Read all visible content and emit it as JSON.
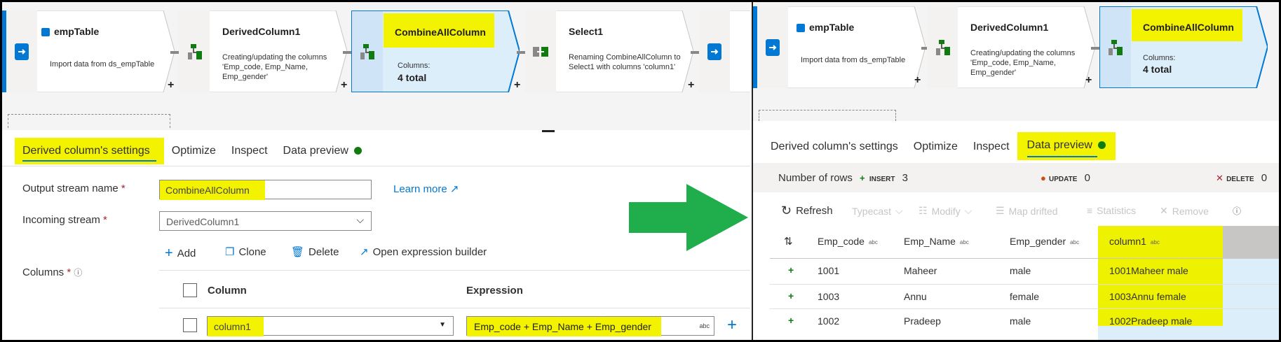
{
  "left": {
    "nodes": [
      {
        "title": "empTable",
        "desc": "Import data from ds_empTable"
      },
      {
        "title": "DerivedColumn1",
        "desc": "Creating/updating the columns 'Emp_code, Emp_Name, Emp_gender'"
      },
      {
        "title": "CombineAllColumn",
        "cols_label": "Columns:",
        "cols_total": "4 total"
      },
      {
        "title": "Select1",
        "desc": "Renaming CombineAllColumn to Select1 with columns 'column1'"
      }
    ],
    "plus": "+",
    "tabs": [
      "Derived column's settings",
      "Optimize",
      "Inspect",
      "Data preview"
    ],
    "output_label": "Output stream name",
    "output_value": "CombineAllColumn",
    "learn_more": "Learn more",
    "incoming_label": "Incoming stream",
    "incoming_value": "DerivedColumn1",
    "required": "*",
    "toolbar": {
      "add": "Add",
      "clone": "Clone",
      "delete": "Delete",
      "expr": "Open expression builder"
    },
    "columns_label": "Columns",
    "col_header": "Column",
    "expr_header": "Expression",
    "row": {
      "column": "column1",
      "expression": "Emp_code + Emp_Name + Emp_gender",
      "type": "abc"
    }
  },
  "right": {
    "nodes": [
      {
        "title": "empTable",
        "desc": "Import data from ds_empTable"
      },
      {
        "title": "DerivedColumn1",
        "desc": "Creating/updating the columns 'Emp_code, Emp_Name, Emp_gender'"
      },
      {
        "title": "CombineAllColumn",
        "cols_label": "Columns:",
        "cols_total": "4 total"
      }
    ],
    "tabs": [
      "Derived column's settings",
      "Optimize",
      "Inspect",
      "Data preview"
    ],
    "rows_label": "Number of rows",
    "insert_label": "INSERT",
    "insert_count": "3",
    "update_label": "UPDATE",
    "update_count": "0",
    "delete_label": "DELETE",
    "delete_count": "0",
    "toolbar": {
      "refresh": "Refresh",
      "typecast": "Typecast",
      "modify": "Modify",
      "map": "Map drifted",
      "stats": "Statistics",
      "remove": "Remove"
    },
    "headers": [
      "Emp_code",
      "Emp_Name",
      "Emp_gender",
      "column1"
    ],
    "type_tag": "abc",
    "rows": [
      [
        "1001",
        "Maheer",
        "male",
        "1001Maheer male"
      ],
      [
        "1003",
        "Annu",
        "female",
        "1003Annu female"
      ],
      [
        "1002",
        "Pradeep",
        "male",
        "1002Pradeep male"
      ]
    ]
  },
  "colors": {
    "accent": "#0078d4",
    "highlight": "#f3f300",
    "success": "#107c10",
    "arrow": "#1fae4b",
    "selected_node": "#ddeefb"
  }
}
